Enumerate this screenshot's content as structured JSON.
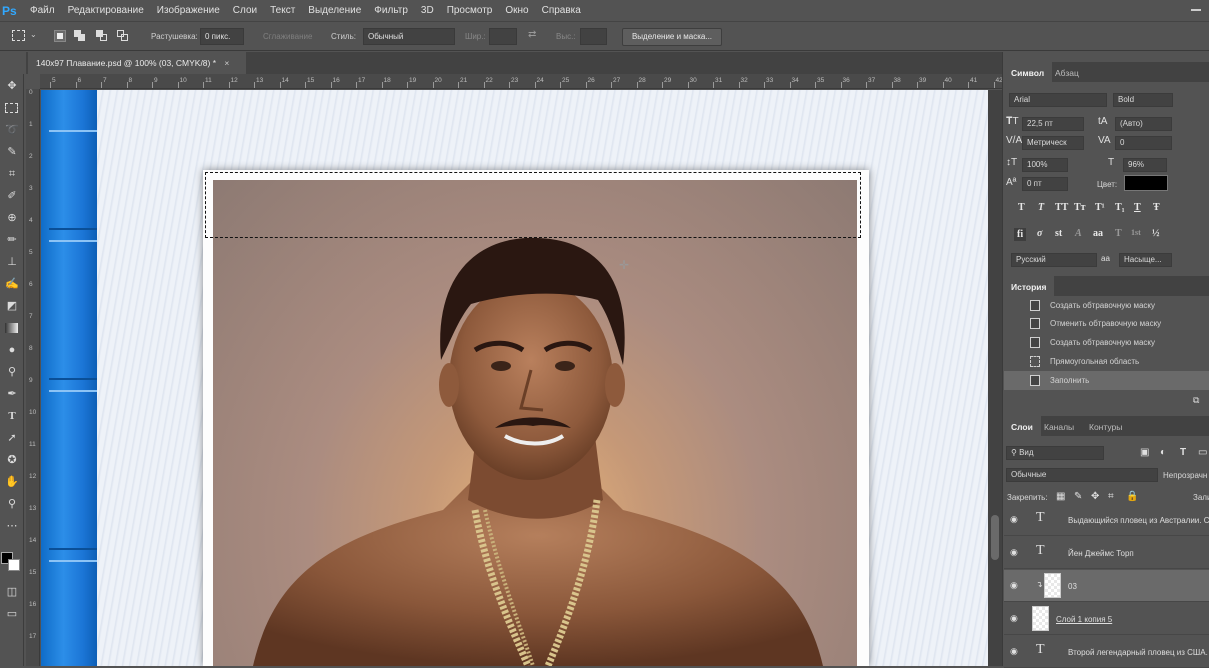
{
  "app": {
    "logo": "Ps",
    "menu": [
      "Файл",
      "Редактирование",
      "Изображение",
      "Слои",
      "Текст",
      "Выделение",
      "Фильтр",
      "3D",
      "Просмотр",
      "Окно",
      "Справка"
    ]
  },
  "options": {
    "feather_label": "Растушевка:",
    "feather_value": "0 пикс.",
    "antialias_label": "Сглаживание",
    "style_label": "Стиль:",
    "style_value": "Обычный",
    "width_label": "Шир.:",
    "height_label": "Выс.:",
    "select_mask_button": "Выделение и маска..."
  },
  "document": {
    "tab_title": "140x97 Плавание.psd @ 100% (03, CMYK/8) *",
    "close_icon": "×"
  },
  "rulers": {
    "top": [
      "5",
      "6",
      "7",
      "8",
      "9",
      "10",
      "11",
      "12",
      "13",
      "14",
      "15",
      "16",
      "17",
      "18",
      "19",
      "20",
      "21",
      "22",
      "23",
      "24",
      "25",
      "26",
      "27",
      "28",
      "29",
      "30",
      "31",
      "32",
      "33",
      "34",
      "35",
      "36",
      "37",
      "38",
      "39",
      "40",
      "41",
      "42"
    ],
    "left": [
      "0",
      "1",
      "2",
      "3",
      "4",
      "5",
      "6",
      "7",
      "8",
      "9",
      "10",
      "11",
      "12",
      "13",
      "14",
      "15",
      "16",
      "17"
    ]
  },
  "character_panel": {
    "tabs": [
      "Символ",
      "Абзац"
    ],
    "font_family": "Arial",
    "font_style": "Bold",
    "size": "22,5 пт",
    "leading": "(Авто)",
    "kerning": "Метрическ",
    "tracking": "0",
    "vertical_scale": "100%",
    "horizontal_scale": "96%",
    "baseline_shift": "0 пт",
    "color_label": "Цвет:",
    "color": "#000000",
    "type_styles": [
      "T",
      "T",
      "TT",
      "Tт",
      "T¹",
      "T₁",
      "T",
      "Ŧ"
    ],
    "opentype": [
      "fi",
      "σ",
      "st",
      "A",
      "aa",
      "T",
      "1st",
      "½"
    ],
    "language": "Русский",
    "antialias": "Насыще..."
  },
  "history_panel": {
    "tab": "История",
    "items": [
      {
        "label": "Создать обтравочную маску",
        "selected": false
      },
      {
        "label": "Отменить обтравочную маску",
        "selected": false
      },
      {
        "label": "Создать обтравочную маску",
        "selected": false
      },
      {
        "label": "Прямоугольная область",
        "selected": false
      },
      {
        "label": "Заполнить",
        "selected": true
      }
    ]
  },
  "layers_panel": {
    "tabs": [
      "Слои",
      "Каналы",
      "Контуры"
    ],
    "filter_kind": "Вид",
    "blend_mode": "Обычные",
    "opacity_label": "Непрозрачн",
    "lock_label": "Закрепить:",
    "fill_label": "Зали",
    "layers": [
      {
        "name": "Выдающийся пловец из Австралии. Сп",
        "type": "text",
        "selected": false
      },
      {
        "name": "Йен Джеймс Торп",
        "type": "text",
        "selected": false
      },
      {
        "name": "03",
        "type": "pixel",
        "selected": true
      },
      {
        "name": "Слой 1 копия 5",
        "type": "pixel",
        "selected": false
      },
      {
        "name": "Второй легендарный пловец из США. С",
        "type": "text",
        "selected": false
      }
    ]
  }
}
